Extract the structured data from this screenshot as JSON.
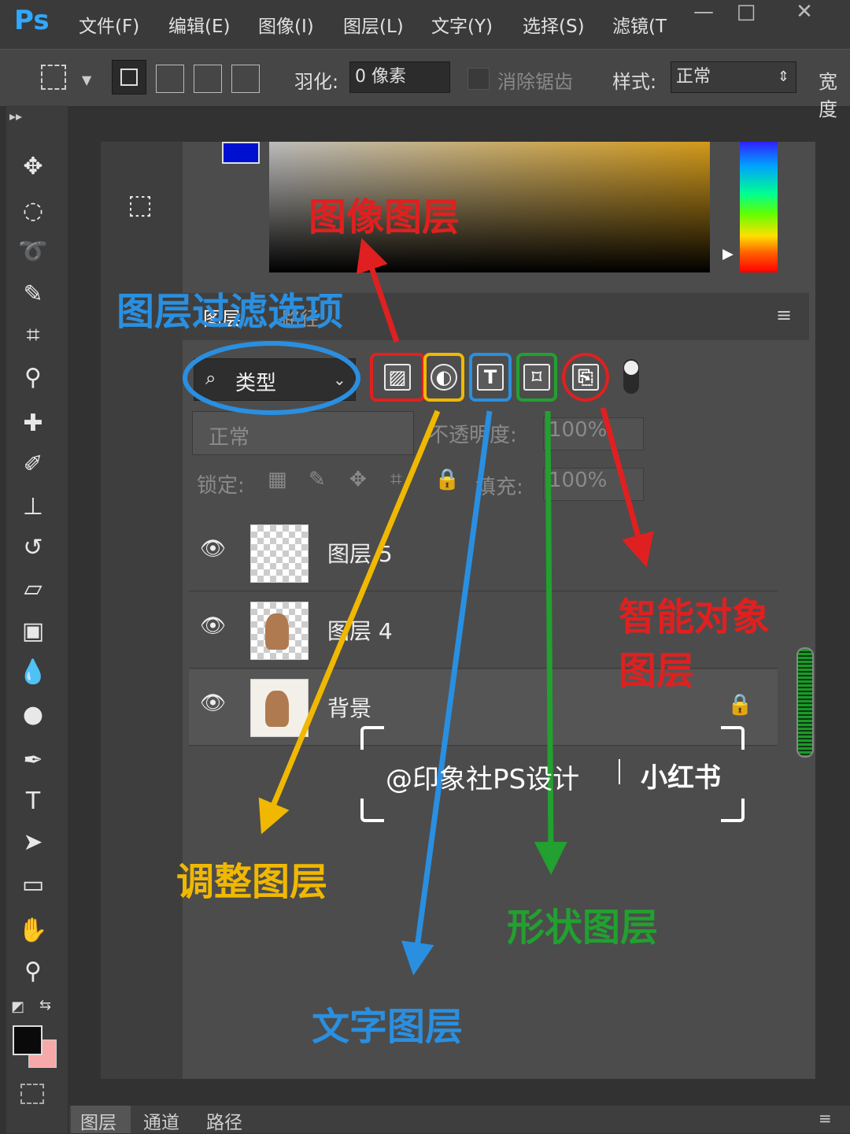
{
  "app": {
    "logo": "Ps"
  },
  "menu": [
    "文件(F)",
    "编辑(E)",
    "图像(I)",
    "图层(L)",
    "文字(Y)",
    "选择(S)",
    "滤镜(T"
  ],
  "window_buttons": [
    "—",
    "□",
    "✕"
  ],
  "options": {
    "feather_label": "羽化:",
    "feather_value": "0 像素",
    "antialias_label": "消除锯齿",
    "style_label": "样式:",
    "style_value": "正常",
    "width_label": "宽度"
  },
  "panel": {
    "tabs": [
      "图层",
      "路径"
    ],
    "filter_type": "类型",
    "blend_mode": "正常",
    "opacity_label": "不透明度:",
    "opacity_value": "100%",
    "lock_label": "锁定:",
    "fill_label": "填充:",
    "fill_value": "100%",
    "filter_icons": [
      {
        "name": "pixel-layer-filter",
        "color": "#e02020"
      },
      {
        "name": "adjustment-layer-filter",
        "color": "#f0b800"
      },
      {
        "name": "type-layer-filter",
        "color": "#2a8fe0",
        "glyph": "T"
      },
      {
        "name": "shape-layer-filter",
        "color": "#22a030"
      },
      {
        "name": "smart-object-filter",
        "color": "#e02020"
      }
    ],
    "layers": [
      {
        "name": "图层 5"
      },
      {
        "name": "图层 4"
      },
      {
        "name": "背景"
      }
    ]
  },
  "annotations": {
    "pixel": "图像图层",
    "filter_options": "图层过滤选项",
    "smart_object_1": "智能对象",
    "smart_object_2": "图层",
    "adjustment": "调整图层",
    "type": "文字图层",
    "shape": "形状图层"
  },
  "watermark": {
    "text": "@印象社PS设计",
    "brand": "小红书"
  },
  "bottom_tabs": [
    "图层",
    "通道",
    "路径"
  ],
  "colors": {
    "red": "#e02020",
    "yellow": "#f0b800",
    "blue": "#2a8fe0",
    "green": "#22a030"
  }
}
